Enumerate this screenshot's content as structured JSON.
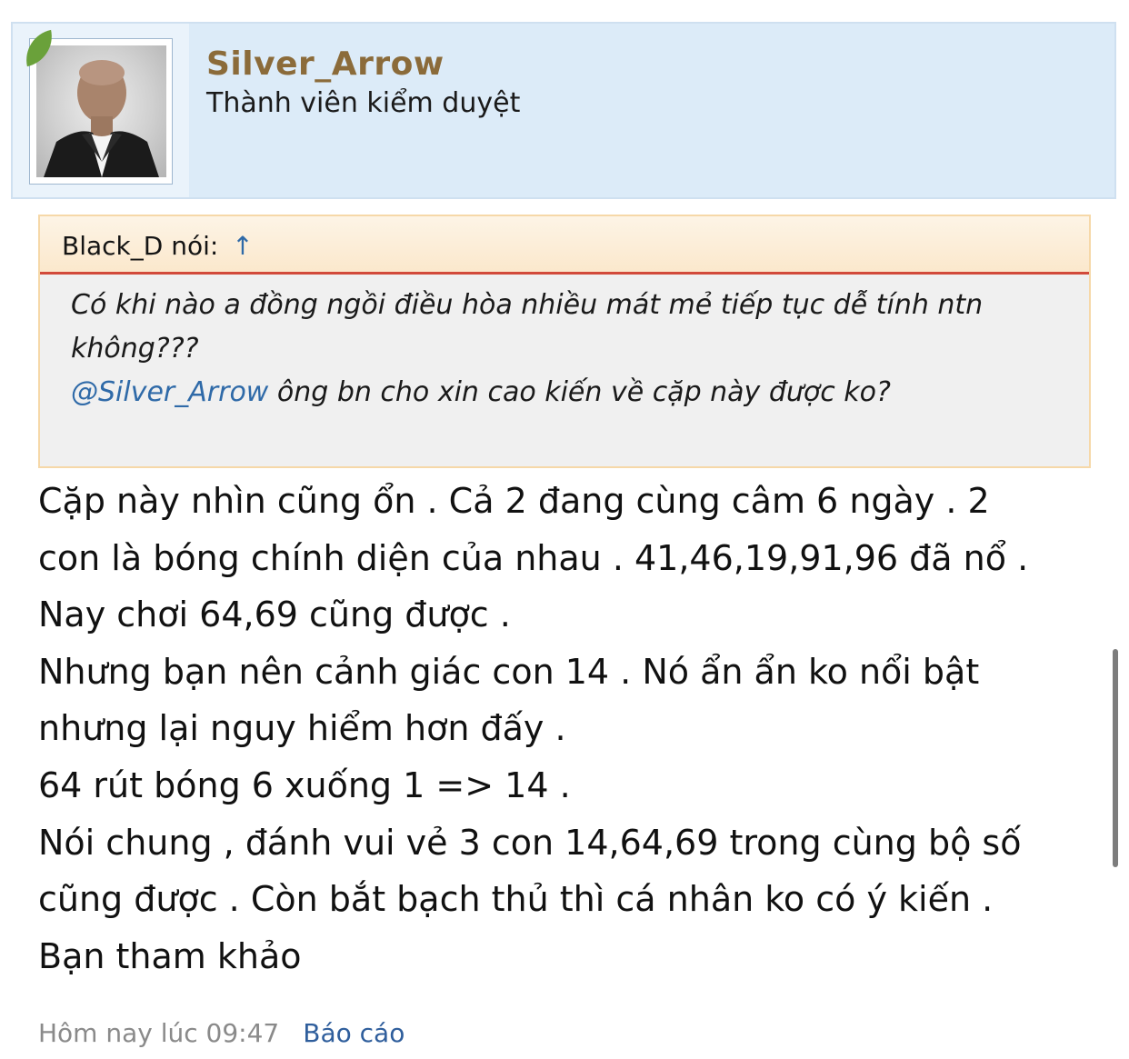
{
  "user": {
    "name": "Silver_Arrow",
    "title": "Thành viên kiểm duyệt"
  },
  "quote": {
    "author_label": "Black_D nói:",
    "arrow": "↑",
    "line1": "Có khi nào a đồng ngồi điều hòa nhiều mát mẻ tiếp tục dễ tính ntn",
    "line2": "không???",
    "mention": "@Silver_Arrow",
    "line3_rest": " ông bn cho xin cao kiến về cặp này được ko?"
  },
  "message": {
    "lines": [
      "Cặp này nhìn cũng ổn . Cả 2 đang cùng câm 6 ngày . 2",
      "con là bóng chính diện của nhau . 41,46,19,91,96 đã nổ .",
      "Nay chơi 64,69 cũng được .",
      "Nhưng bạn nên cảnh giác con 14 . Nó ẩn ẩn ko nổi bật",
      "nhưng lại nguy hiểm hơn đấy .",
      "64 rút bóng 6 xuống 1 => 14 .",
      "Nói chung , đánh vui vẻ 3 con 14,64,69 trong cùng bộ số",
      "cũng được . Còn bắt bạch thủ thì cá nhân ko có ý kiến .",
      "Bạn tham khảo"
    ]
  },
  "footer": {
    "timestamp": "Hôm nay lúc 09:47",
    "report_label": "Báo cáo"
  }
}
